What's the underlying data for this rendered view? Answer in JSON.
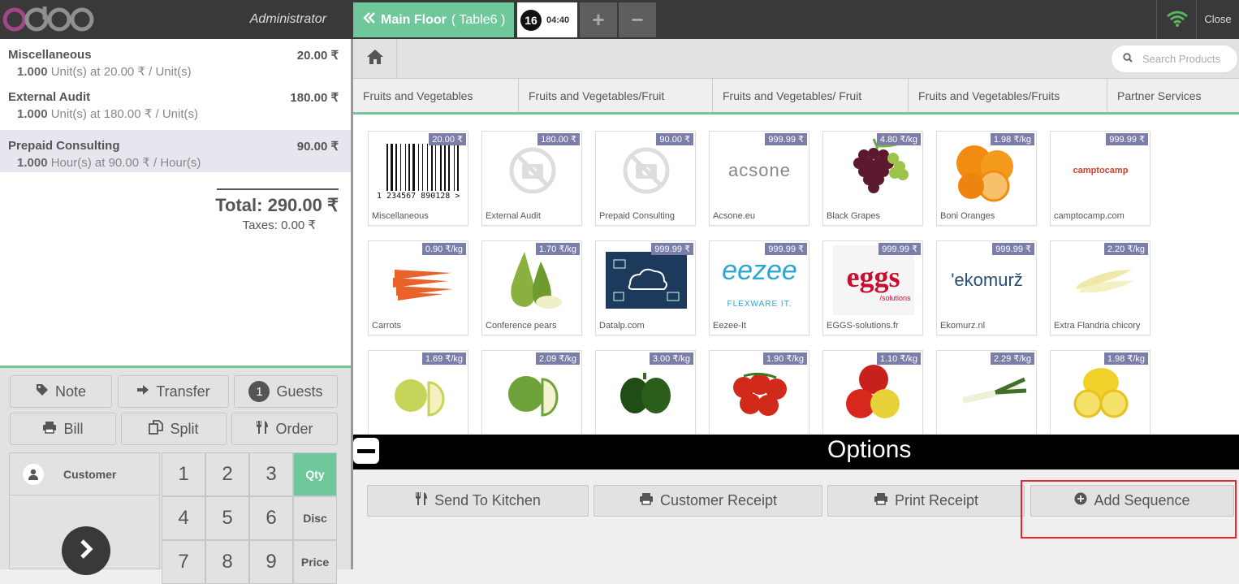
{
  "header": {
    "logo_text": "odoo",
    "user": "Administrator",
    "floor_label": "Main Floor",
    "table_label": "( Table6 )",
    "order_number": "16",
    "order_time": "04:40",
    "add_label": "+",
    "remove_label": "−",
    "close_label": "Close"
  },
  "order": {
    "lines": [
      {
        "name": "Miscellaneous",
        "price": "20.00 ₹",
        "qty": "1.000",
        "info": "Unit(s) at 20.00 ₹ / Unit(s)"
      },
      {
        "name": "External Audit",
        "price": "180.00 ₹",
        "qty": "1.000",
        "info": "Unit(s) at 180.00 ₹ / Unit(s)"
      },
      {
        "name": "Prepaid Consulting",
        "price": "90.00 ₹",
        "qty": "1.000",
        "info": "Hour(s) at 90.00 ₹ / Hour(s)"
      }
    ],
    "total": "Total: 290.00 ₹",
    "taxes": "Taxes: 0.00 ₹"
  },
  "controls": {
    "note": "Note",
    "transfer": "Transfer",
    "guests_count": "1",
    "guests": "Guests",
    "bill": "Bill",
    "split": "Split",
    "order": "Order",
    "customer": "Customer"
  },
  "numpad": {
    "keys": [
      "1",
      "2",
      "3",
      "4",
      "5",
      "6",
      "7",
      "8",
      "9"
    ],
    "modes": [
      "Qty",
      "Disc",
      "Price"
    ]
  },
  "search": {
    "placeholder": "Search Products"
  },
  "categories": [
    "Fruits and Vegetables",
    "Fruits and Vegetables/Fruit",
    "Fruits and Vegetables/ Fruit",
    "Fruits and Vegetables/Fruits",
    "Partner Services"
  ],
  "products": [
    {
      "name": "Miscellaneous",
      "price": "20.00 ₹",
      "img": "barcode",
      "barcode_text": "1 234567 890128 >"
    },
    {
      "name": "External Audit",
      "price": "180.00 ₹",
      "img": "nophoto"
    },
    {
      "name": "Prepaid Consulting",
      "price": "90.00 ₹",
      "img": "nophoto"
    },
    {
      "name": "Acsone.eu",
      "price": "999.99 ₹",
      "img": "acsone",
      "logo_text": "acsone"
    },
    {
      "name": "Black Grapes",
      "price": "4.80 ₹/kg",
      "img": "grapes"
    },
    {
      "name": "Boni Oranges",
      "price": "1.98 ₹/kg",
      "img": "oranges"
    },
    {
      "name": "camptocamp.com",
      "price": "999.99 ₹",
      "img": "camptocamp",
      "logo_text": "camptocamp"
    },
    {
      "name": "Carrots",
      "price": "0.90 ₹/kg",
      "img": "carrots"
    },
    {
      "name": "Conference pears",
      "price": "1.70 ₹/kg",
      "img": "pears"
    },
    {
      "name": "Datalp.com",
      "price": "999.99 ₹",
      "img": "datalp"
    },
    {
      "name": "Eezee-It",
      "price": "999.99 ₹",
      "img": "eezee",
      "logo_text": "eezee",
      "logo_sub": "FLEXWARE IT."
    },
    {
      "name": "EGGS-solutions.fr",
      "price": "999.99 ₹",
      "img": "eggs",
      "logo_text": "eggs",
      "logo_sub": "/solutions"
    },
    {
      "name": "Ekomurz.nl",
      "price": "999.99 ₹",
      "img": "ekomurz",
      "logo_text": "'ekomurž"
    },
    {
      "name": "Extra Flandria chicory",
      "price": "2.20 ₹/kg",
      "img": "chicory"
    },
    {
      "name": "",
      "price": "1.69 ₹/kg",
      "img": "apple_yellow"
    },
    {
      "name": "",
      "price": "2.09 ₹/kg",
      "img": "apple_green"
    },
    {
      "name": "",
      "price": "3.00 ₹/kg",
      "img": "pepper"
    },
    {
      "name": "",
      "price": "1.90 ₹/kg",
      "img": "tomatoes"
    },
    {
      "name": "",
      "price": "1.10 ₹/kg",
      "img": "apples_red"
    },
    {
      "name": "",
      "price": "2.29 ₹/kg",
      "img": "leek"
    },
    {
      "name": "",
      "price": "1.98 ₹/kg",
      "img": "lemons"
    }
  ],
  "options": {
    "title": "Options",
    "buttons": [
      "Send To Kitchen",
      "Customer Receipt",
      "Print Receipt",
      "Add Sequence"
    ]
  },
  "colors": {
    "accent": "#6ec89b",
    "dark": "#393939",
    "price_tag": "#7a7ea8",
    "highlight": "#e5262b"
  }
}
